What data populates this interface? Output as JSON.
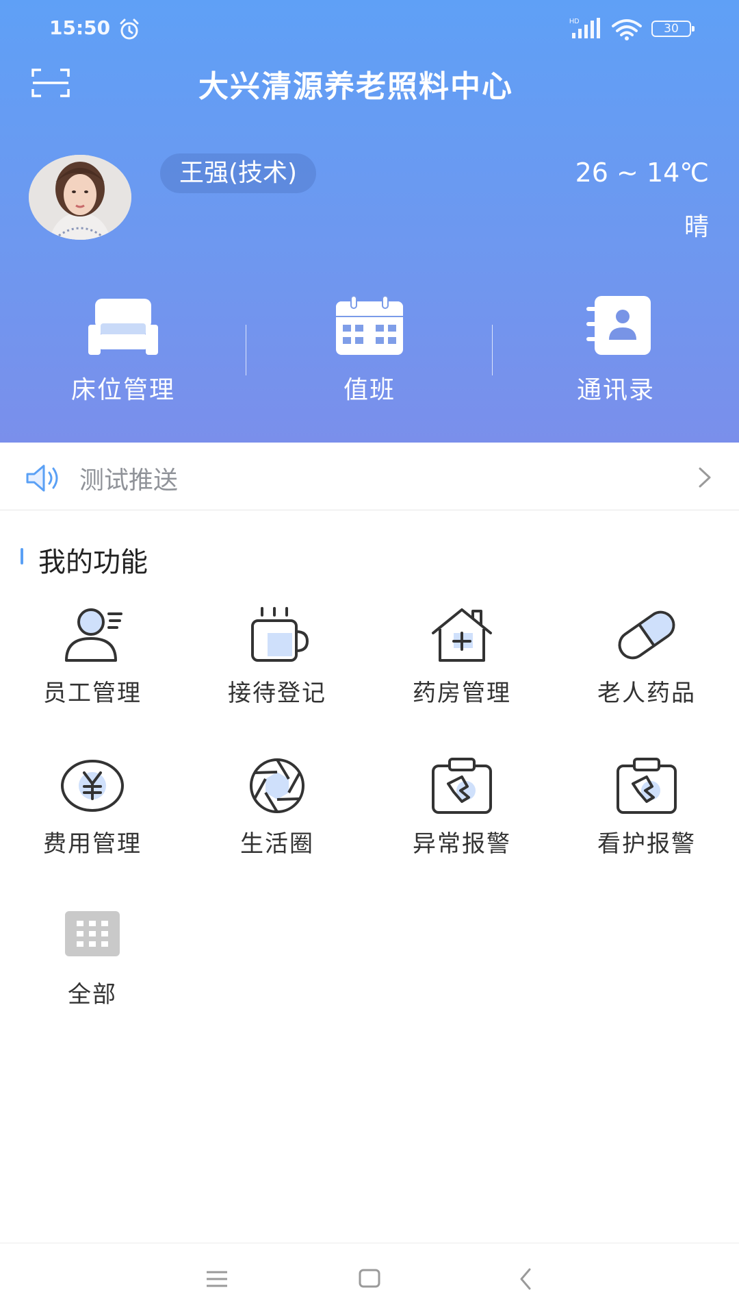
{
  "status_bar": {
    "time": "15:50",
    "battery": "30"
  },
  "header": {
    "title": "大兴清源养老照料中心"
  },
  "user": {
    "name": "王强(技术)"
  },
  "weather": {
    "temp": "26 ~ 14℃",
    "condition": "晴"
  },
  "quick_actions": [
    {
      "label": "床位管理",
      "icon": "bed-icon"
    },
    {
      "label": "值班",
      "icon": "calendar-icon"
    },
    {
      "label": "通讯录",
      "icon": "contacts-icon"
    }
  ],
  "notice": {
    "text": "测试推送"
  },
  "section": {
    "title": "我的功能"
  },
  "functions": [
    {
      "label": "员工管理",
      "icon": "staff-icon"
    },
    {
      "label": "接待登记",
      "icon": "cup-icon"
    },
    {
      "label": "药房管理",
      "icon": "pharmacy-house-icon"
    },
    {
      "label": "老人药品",
      "icon": "pill-icon"
    },
    {
      "label": "费用管理",
      "icon": "yuan-coin-icon"
    },
    {
      "label": "生活圈",
      "icon": "aperture-icon"
    },
    {
      "label": "异常报警",
      "icon": "alarm-clipboard-icon"
    },
    {
      "label": "看护报警",
      "icon": "care-alarm-clipboard-icon"
    },
    {
      "label": "全部",
      "icon": "grid-icon"
    }
  ],
  "colors": {
    "header_top": "#5fa0f6",
    "header_bottom": "#7a8feb",
    "accent": "#5aa0f5",
    "icon_fill": "#cfe0fb",
    "icon_stroke": "#333333"
  }
}
